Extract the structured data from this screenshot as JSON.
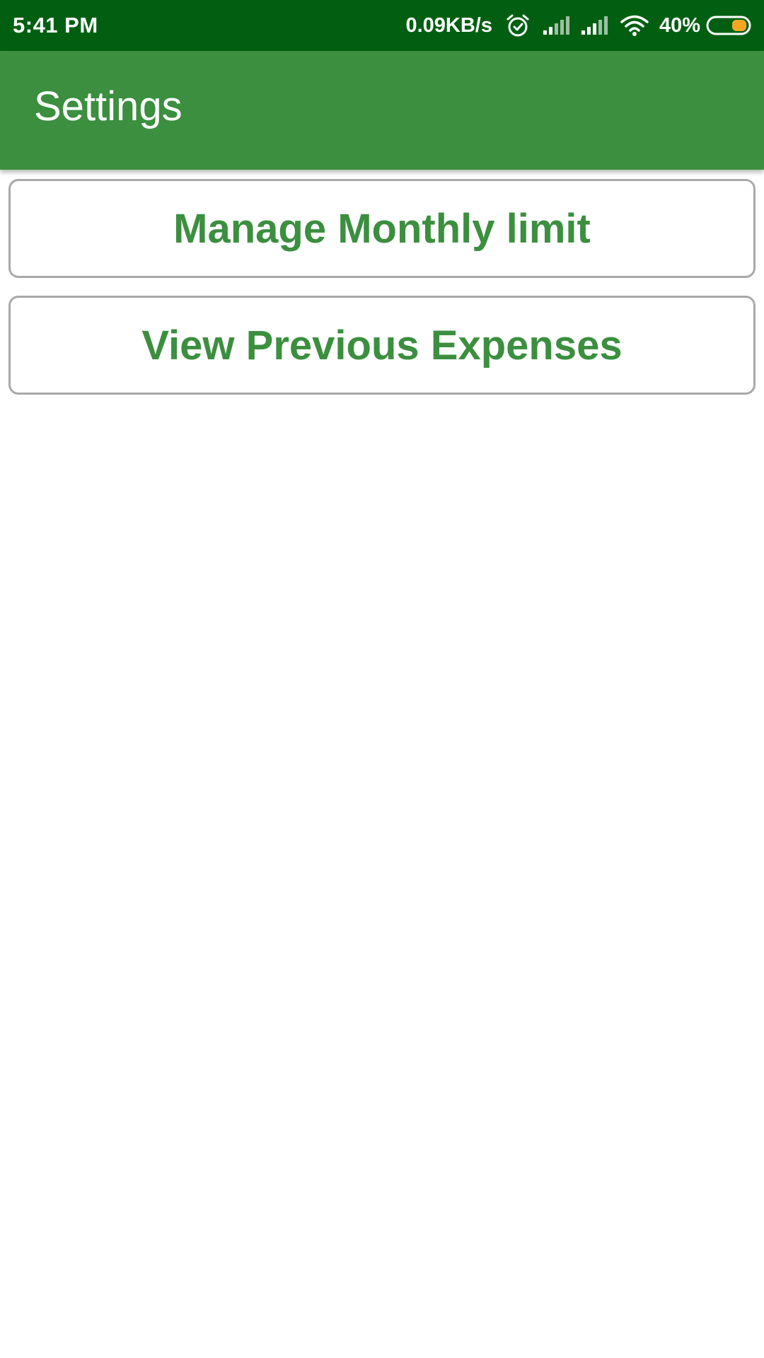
{
  "status_bar": {
    "time": "5:41 PM",
    "network_speed": "0.09KB/s",
    "battery_percent": "40%",
    "battery_level": 0.4,
    "icons": [
      "alarm-icon",
      "signal-icon",
      "signal-icon",
      "wifi-icon",
      "battery-icon"
    ],
    "background_color": "#025f12",
    "battery_fill_color": "#f5a623"
  },
  "app_bar": {
    "title": "Settings",
    "background_color": "#3b8f3f"
  },
  "buttons": [
    {
      "label": "Manage Monthly limit"
    },
    {
      "label": "View Previous Expenses"
    }
  ],
  "accent_color": "#3b8f3f"
}
